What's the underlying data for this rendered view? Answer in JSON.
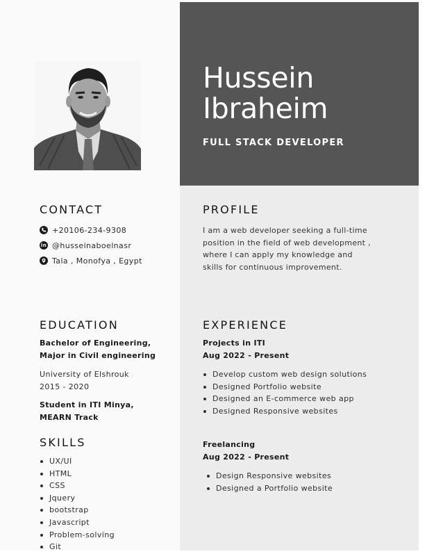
{
  "header": {
    "first_name": "Hussein",
    "last_name": "Ibraheim",
    "job_title": "FULL STACK DEVELOPER"
  },
  "contact": {
    "heading": "CONTACT",
    "phone": "+20106-234-9308",
    "linkedin": "@husseinaboelnasr",
    "location": "Tala , Monofya , Egypt"
  },
  "profile": {
    "heading": "PROFILE",
    "lines": [
      "I am a web developer seeking a full-time",
      "position in the field of web development ,",
      "where I can apply my knowledge and",
      "skills for continuous improvement."
    ]
  },
  "education": {
    "heading": "EDUCATION",
    "degree_line1": "Bachelor of Engineering,",
    "degree_line2": "Major in Civil engineering",
    "university": "University of Elshrouk",
    "years": "2015 - 2020",
    "iti_line1": "Student in ITI Minya,",
    "iti_line2": "MEARN Track"
  },
  "skills": {
    "heading": "SKILLS",
    "items": [
      "UX/UI",
      "HTML",
      "CSS",
      "Jquery",
      "bootstrap",
      "Javascript",
      "Problem-solving",
      "Git"
    ]
  },
  "experience": {
    "heading": "EXPERIENCE",
    "jobs": [
      {
        "title": "Projects in ITI",
        "dates": "Aug 2022 - Present",
        "items": [
          "Develop custom web design solutions",
          "Designed Portfolio website",
          "Designed an E-commerce web app",
          "Designed Responsive websites"
        ]
      },
      {
        "title": "Freelancing",
        "dates": "Aug 2022 - Present",
        "items": [
          "Design Responsive websites",
          "Designed a Portfolio website"
        ]
      }
    ]
  },
  "colors": {
    "header_bg": "#555555",
    "panel_bg": "#ececec",
    "page_bg": "#fafafa"
  },
  "icons": {
    "phone": "phone-icon",
    "linkedin": "linkedin-icon",
    "location": "location-pin-icon"
  }
}
